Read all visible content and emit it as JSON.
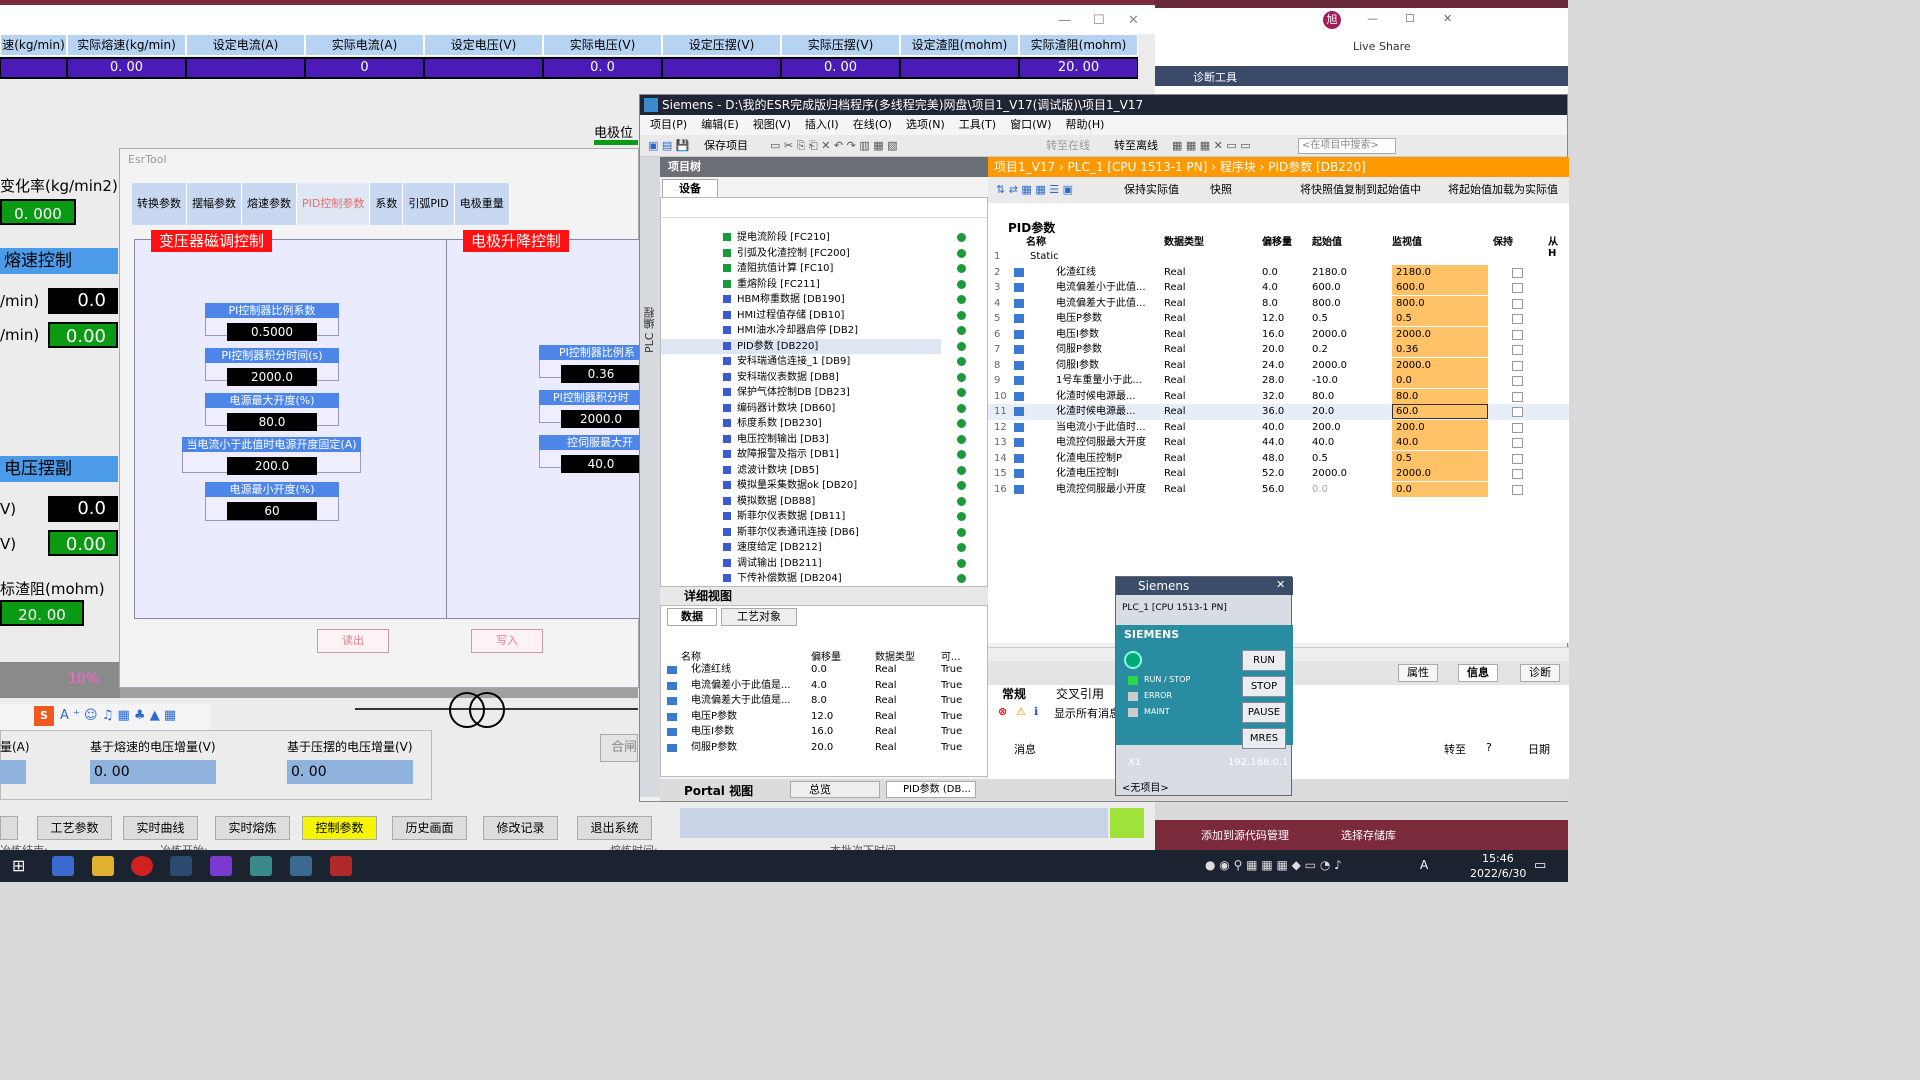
{
  "hmi": {
    "headers": [
      "速(kg/min)",
      "实际熔速(kg/min)",
      "设定电流(A)",
      "实际电流(A)",
      "设定电压(V)",
      "实际电压(V)",
      "设定压摆(V)",
      "实际压摆(V)",
      "设定渣阻(mohm)",
      "实际渣阻(mohm)"
    ],
    "values": [
      "",
      "0. 00",
      "",
      "0",
      "",
      "0. 0",
      "",
      "0. 00",
      "",
      "20. 00"
    ],
    "electrode_pos": "电极位",
    "change_rate": "变化率(kg/min2)",
    "change_rate_val": "0. 000",
    "melt_ctrl": "熔速控制",
    "min1": "/min)",
    "min1_val": "0.0",
    "min2": "/min)",
    "min2_val": "0.00",
    "volt_swing": "电压摆副",
    "v1": "V)",
    "v1_val": "0.0",
    "v2": "V)",
    "v2_val": "0.00",
    "slag": "标渣阻(mohm)",
    "slag_val": "20. 00",
    "pct": "10%",
    "inc_a": "量(A)",
    "inc_melt": "基于熔速的电压增量(V)",
    "inc_melt_val": "0. 00",
    "inc_swing": "基于压摆的电压增量(V)",
    "inc_swing_val": "0. 00",
    "close_label": "合闸",
    "nav": [
      "工艺参数",
      "实时曲线",
      "实时熔炼",
      "控制参数",
      "历史画面",
      "修改记录",
      "退出系统"
    ],
    "bottom_a": "冶炼结束:",
    "bottom_b": "冶炼开始:",
    "bottom_c": "熔炼时间:",
    "bottom_d": "本批次下时间"
  },
  "esr": {
    "title": "EsrTool",
    "tabs": [
      "转换参数",
      "摆幅参数",
      "熔速参数",
      "PID控制参数",
      "系数",
      "引弧PID",
      "电极重量"
    ],
    "left_header": "变压器磁调控制",
    "right_header": "电极升降控制",
    "params": [
      {
        "label": "PI控制器比例系数",
        "value": "0.5000"
      },
      {
        "label": "PI控制器积分时间(s)",
        "value": "2000.0"
      },
      {
        "label": "电源最大开度(%)",
        "value": "80.0"
      },
      {
        "label": "当电流小于此值时电源开度固定(A)",
        "value": "200.0"
      },
      {
        "label": "电源最小开度(%)",
        "value": "60"
      }
    ],
    "right_params": [
      {
        "label": "PI控制器比例系",
        "value": "0.36"
      },
      {
        "label": "PI控制器积分时",
        "value": "2000.0"
      },
      {
        "label": "控伺服最大开",
        "value": "40.0"
      }
    ],
    "read": "读出",
    "write": "写入"
  },
  "tia": {
    "title": "Siemens  -  D:\\我的ESR完成版归档程序(多线程完美)网盘\\项目1_V17(调试版)\\项目1_V17",
    "menu": [
      "项目(P)",
      "编辑(E)",
      "视图(V)",
      "插入(I)",
      "在线(O)",
      "选项(N)",
      "工具(T)",
      "窗口(W)",
      "帮助(H)"
    ],
    "save": "保存项目",
    "go_online": "转至在线",
    "go_offline": "转至离线",
    "search": "<在项目中搜索>",
    "tree_title": "项目树",
    "devices_tab": "设备",
    "plc_side": "PLC 编程",
    "tree": [
      "提电流阶段 [FC210]",
      "引弧及化渣控制 [FC200]",
      "渣阻抗值计算 [FC10]",
      "重熔阶段 [FC211]",
      "HBM称重数据 [DB190]",
      "HMI过程值存储 [DB10]",
      "HMI油水冷却器启停 [DB2]",
      "PID参数 [DB220]",
      "安科瑞通信连接_1 [DB9]",
      "安科瑞仪表数据 [DB8]",
      "保护气体控制DB [DB23]",
      "编码器计数块 [DB60]",
      "标度系数 [DB230]",
      "电压控制输出 [DB3]",
      "故障报警及指示 [DB1]",
      "滤波计数块 [DB5]",
      "模拟量采集数据ok [DB20]",
      "模拟数据 [DB88]",
      "斯菲尔仪表数据 [DB11]",
      "斯菲尔仪表通讯连接 [DB6]",
      "速度给定 [DB212]",
      "调试输出 [DB211]",
      "下传补偿数据 [DB204]"
    ],
    "breadcrumb": "项目1_V17  ›  PLC_1 [CPU 1513-1 PN]  ›  程序块  ›  PID参数 [DB220]",
    "db_toolbar": [
      "保持实际值",
      "快照",
      "将快照值复制到起始值中",
      "将起始值加载为实际值"
    ],
    "db_name": "PID参数",
    "cols": [
      "名称",
      "数据类型",
      "偏移量",
      "起始值",
      "监视值",
      "保持",
      "从 H"
    ],
    "static": "Static",
    "rows": [
      [
        "化渣红线",
        "Real",
        "0.0",
        "2180.0",
        "2180.0"
      ],
      [
        "电流偏差小于此值...",
        "Real",
        "4.0",
        "600.0",
        "600.0"
      ],
      [
        "电流偏差大于此值...",
        "Real",
        "8.0",
        "800.0",
        "800.0"
      ],
      [
        "电压P参数",
        "Real",
        "12.0",
        "0.5",
        "0.5"
      ],
      [
        "电压I参数",
        "Real",
        "16.0",
        "2000.0",
        "2000.0"
      ],
      [
        "伺服P参数",
        "Real",
        "20.0",
        "0.2",
        "0.36"
      ],
      [
        "伺服I参数",
        "Real",
        "24.0",
        "2000.0",
        "2000.0"
      ],
      [
        "1号车重量小于此...",
        "Real",
        "28.0",
        "-10.0",
        "0.0"
      ],
      [
        "化渣时候电源最...",
        "Real",
        "32.0",
        "80.0",
        "80.0"
      ],
      [
        "化渣时候电源最...",
        "Real",
        "36.0",
        "20.0",
        "60.0"
      ],
      [
        "当电流小于此值时...",
        "Real",
        "40.0",
        "200.0",
        "200.0"
      ],
      [
        "电流控伺服最大开度",
        "Real",
        "44.0",
        "40.0",
        "40.0"
      ],
      [
        "化渣电压控制P",
        "Real",
        "48.0",
        "0.5",
        "0.5"
      ],
      [
        "化渣电压控制I",
        "Real",
        "52.0",
        "2000.0",
        "2000.0"
      ],
      [
        "电流控伺服最小开度",
        "Real",
        "56.0",
        "0.0",
        "0.0"
      ]
    ],
    "detail_title": "详细视图",
    "detail_tabs": [
      "数据",
      "工艺对象"
    ],
    "detail_cols": [
      "名称",
      "偏移量",
      "数据类型",
      "可..."
    ],
    "detail_rows": [
      [
        "化渣红线",
        "0.0",
        "Real",
        "True"
      ],
      [
        "电流偏差小于此值是...",
        "4.0",
        "Real",
        "True"
      ],
      [
        "电流偏差大于此值是...",
        "8.0",
        "Real",
        "True"
      ],
      [
        "电压P参数",
        "12.0",
        "Real",
        "True"
      ],
      [
        "电压I参数",
        "16.0",
        "Real",
        "True"
      ],
      [
        "伺服P参数",
        "20.0",
        "Real",
        "True"
      ]
    ],
    "portal": "Portal 视图",
    "overview": "总览",
    "pid_tab": "PID参数 (DB...",
    "prop_tabs": [
      "属性",
      "信息",
      "诊断"
    ],
    "info_tabs": [
      "常规",
      "交叉引用"
    ],
    "show_all": "显示所有消息",
    "msg_col": "消息",
    "goto_col": "转至",
    "q_col": "?",
    "date_col": "日期",
    "add_src": "添加到源代码管理",
    "sel_repo": "选择存储库"
  },
  "plcsim": {
    "title": "Siemens",
    "cpu": "PLC_1 [CPU 1513-1 PN]",
    "brand": "SIEMENS",
    "run_stop": "RUN / STOP",
    "error": "ERROR",
    "maint": "MAINT",
    "btns": [
      "RUN",
      "STOP",
      "PAUSE",
      "MRES"
    ],
    "x1": "X1",
    "ip": "192.168.0.1",
    "noproj": "<无项目>"
  },
  "vs": {
    "live_share": "Live Share",
    "avatar": "旭",
    "diag": "诊断工具"
  },
  "taskbar": {
    "time": "15:46",
    "date": "2022/6/30",
    "lang": "A"
  }
}
